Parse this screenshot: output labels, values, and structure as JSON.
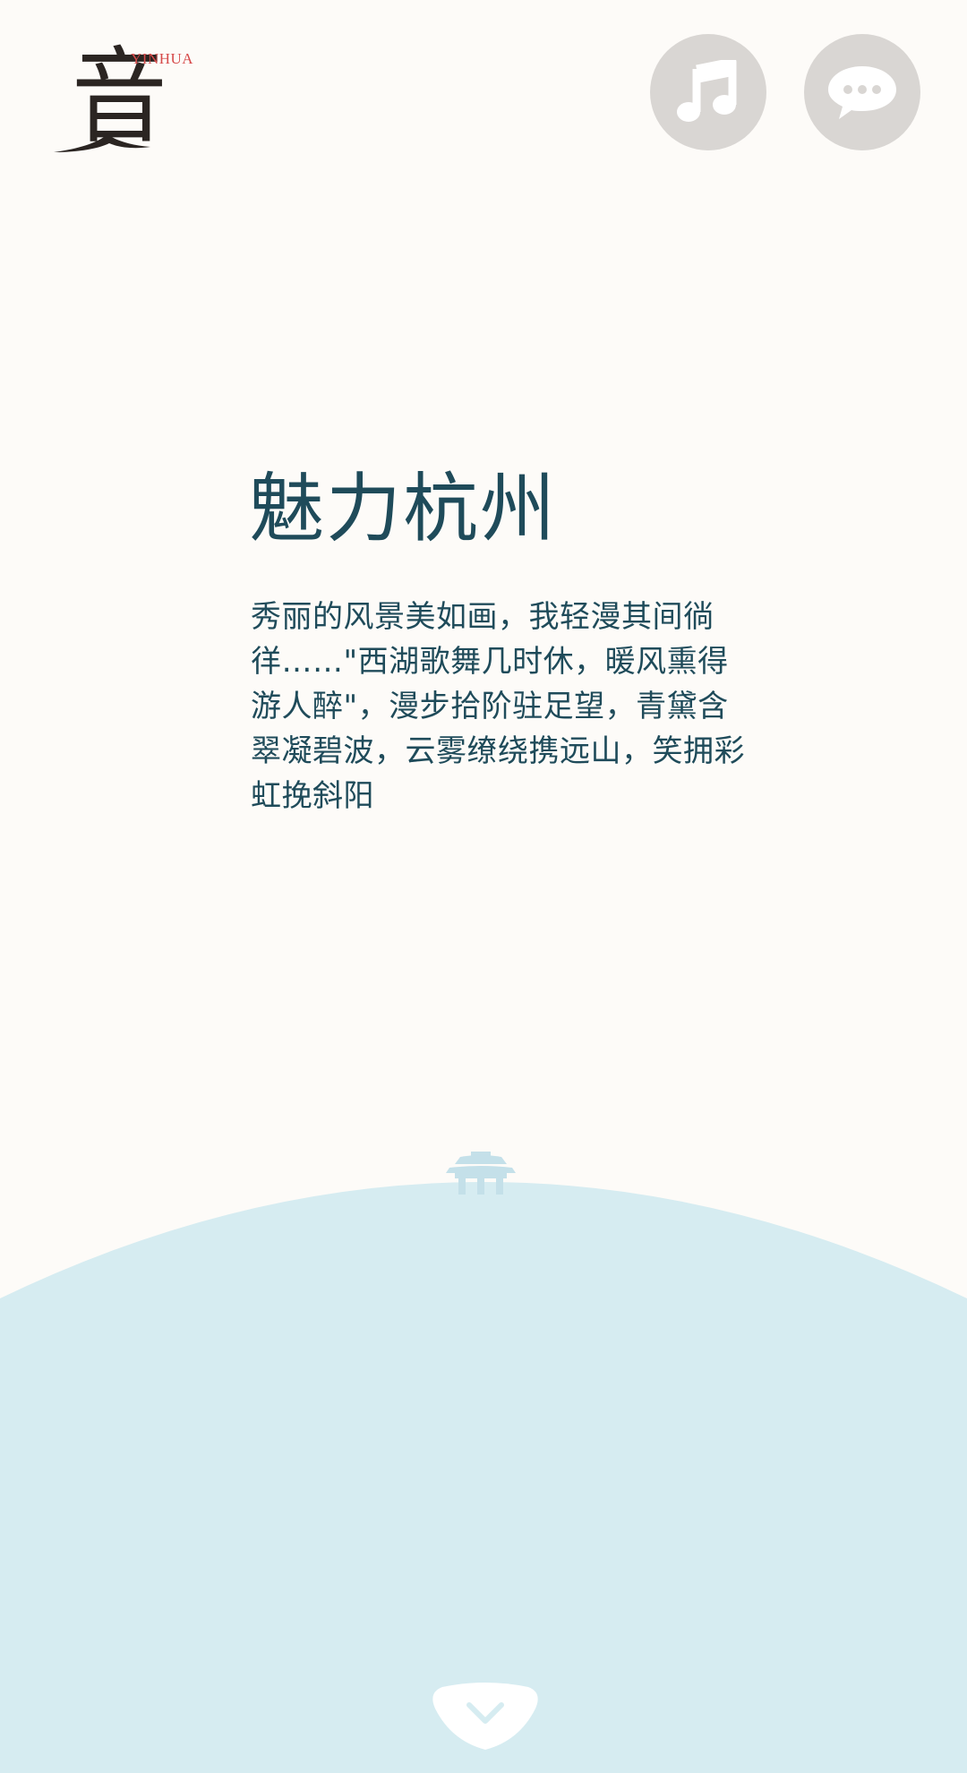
{
  "logo": {
    "glyph": "音",
    "wordmark": "YINHUA"
  },
  "top_bar": {
    "music_button_icon": "music-note-icon",
    "chat_button_icon": "chat-bubble-icon"
  },
  "content": {
    "title": "魅力杭州",
    "paragraph": "秀丽的风景美如画，我轻漫其间徜徉……\"西湖歌舞几时休，暖风熏得游人醉\"，漫步拾阶驻足望，青黛含翠凝碧波，云雾缭绕携远山，笑拥彩虹挽斜阳"
  },
  "footer": {
    "down_button_icon": "chevron-down-icon"
  },
  "colors": {
    "background": "#fdfbf8",
    "text": "#1f4b5a",
    "hill": "#d6ecf1",
    "pavilion": "#c4e0e9",
    "button_gray": "#d9d6d3",
    "logo_red": "#d64a4a"
  }
}
